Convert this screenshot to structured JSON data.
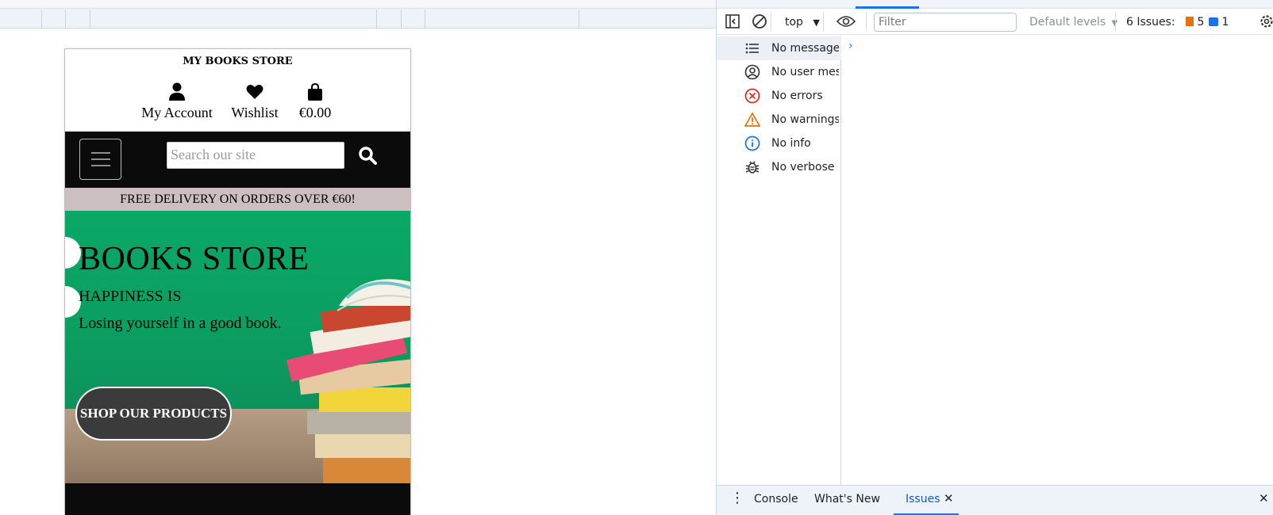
{
  "site": {
    "store_name": "MY BOOKS STORE",
    "account_label": "My Account",
    "wishlist_label": "Wishlist",
    "bag_total": "€0.00",
    "search_placeholder": "Search our site",
    "promo": "FREE DELIVERY ON ORDERS OVER €60!",
    "hero": {
      "title": "BOOKS STORE",
      "subtitle": "HAPPINESS IS",
      "tagline": "Losing yourself in a good book.",
      "cta": "SHOP OUR PRODUCTS"
    }
  },
  "devtools": {
    "context": "top",
    "filter_placeholder": "Filter",
    "levels": "Default levels",
    "issues_label": "6 Issues:",
    "issues_warning_count": "5",
    "issues_info_count": "1",
    "sidebar": [
      {
        "label": "No messages",
        "icon": "list-icon"
      },
      {
        "label": "No user messages",
        "icon": "user-circle-icon"
      },
      {
        "label": "No errors",
        "icon": "error-icon"
      },
      {
        "label": "No warnings",
        "icon": "warning-icon"
      },
      {
        "label": "No info",
        "icon": "info-icon"
      },
      {
        "label": "No verbose",
        "icon": "bug-icon"
      }
    ],
    "drawer_tabs": {
      "console": "Console",
      "whats_new": "What's New",
      "issues": "Issues"
    }
  },
  "colors": {
    "hero_green": "#0aa866",
    "promo_bg": "#cbbfbf",
    "nav_bg": "#0b0b0b",
    "cta_bg": "#3b3b3b",
    "devtools_accent": "#1a73e8"
  }
}
